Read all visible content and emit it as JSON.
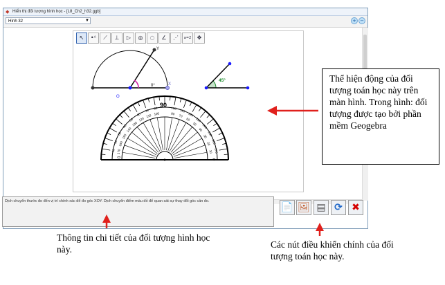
{
  "window": {
    "title": "Hiển thị đối tượng hình học - [L8_Ch2_h32.ggb]",
    "select_value": "Hình 32",
    "zoom_in": "+",
    "zoom_out": "−"
  },
  "geogebra": {
    "tools": [
      {
        "name": "move",
        "glyph": "↖"
      },
      {
        "name": "point",
        "glyph": "•ᴬ"
      },
      {
        "name": "line",
        "glyph": "⟋"
      },
      {
        "name": "perpendicular",
        "glyph": "⊥"
      },
      {
        "name": "polygon",
        "glyph": "▷"
      },
      {
        "name": "circle",
        "glyph": "◎"
      },
      {
        "name": "circle-arc",
        "glyph": "◌"
      },
      {
        "name": "angle",
        "glyph": "∠"
      },
      {
        "name": "reflect",
        "glyph": "⋰"
      },
      {
        "name": "slider",
        "glyph": "a=2"
      },
      {
        "name": "move-view",
        "glyph": "✥"
      }
    ],
    "labels": {
      "y": "Y",
      "x": "X",
      "o": "O",
      "zero": "0°",
      "angle": "45°",
      "ninety": "90",
      "zero_left": "0",
      "zero_right": "0"
    },
    "protractor_outer_ticks": [
      "10",
      "20",
      "30",
      "40",
      "50",
      "60",
      "70",
      "80",
      "100",
      "110",
      "120",
      "130",
      "140",
      "150",
      "160",
      "170"
    ],
    "protractor_inner_ticks": [
      "170",
      "160",
      "150",
      "140",
      "130",
      "120",
      "110",
      "100",
      "80",
      "70",
      "60",
      "50",
      "40",
      "30",
      "20",
      "10"
    ]
  },
  "info": {
    "text": "Dịch chuyển thước đo đến vị trí chính xác để đo góc XOY. Dịch chuyển điểm màu đỏ để quan sát sự thay đổi góc cần đo."
  },
  "controls": [
    {
      "name": "note-button",
      "glyph": "📄"
    },
    {
      "name": "figure-button",
      "glyph": "🖼"
    },
    {
      "name": "construct-button",
      "glyph": "▤"
    },
    {
      "name": "refresh-button",
      "glyph": "⟳"
    },
    {
      "name": "close-button",
      "glyph": "✖"
    }
  ],
  "annotations": {
    "callout": "Thể hiện động của đối tượng toán học này trên màn hình. Trong hình: đối tượng được tạo bởi phần mềm Geogebra",
    "info_note": "Thông tin chi tiết của đối tượng hình học này.",
    "controls_note": "Các nút điều khiển chính của đối tượng toán học này."
  },
  "colors": {
    "arrow": "#e0201c",
    "angle_arc": "#d31aa5",
    "angle_fill": "#1a8a2a",
    "blue_point": "#1a1aff",
    "close_red": "#d40000",
    "refresh_blue": "#1d66c8"
  }
}
